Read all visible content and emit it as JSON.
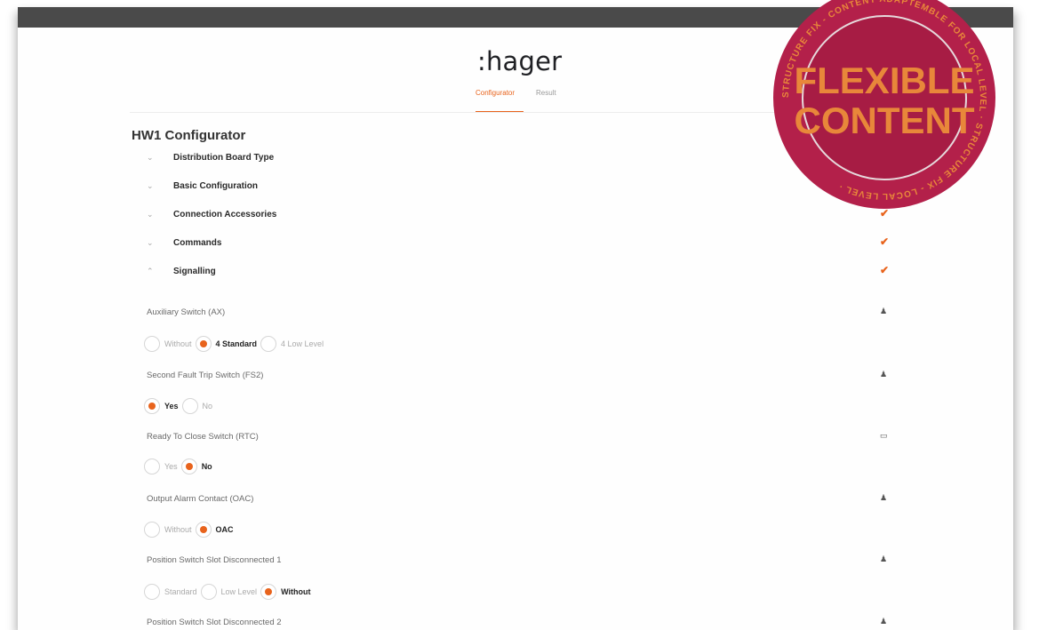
{
  "brand": {
    "logo": ":hager"
  },
  "tabs": [
    {
      "label": "Configurator",
      "active": true
    },
    {
      "label": "Result",
      "active": false
    }
  ],
  "page_title": "HW1 Configurator",
  "sections": [
    {
      "label": "Distribution Board Type",
      "expanded": false,
      "complete": false
    },
    {
      "label": "Basic Configuration",
      "expanded": false,
      "complete": false
    },
    {
      "label": "Connection Accessories",
      "expanded": false,
      "complete": true
    },
    {
      "label": "Commands",
      "expanded": false,
      "complete": true
    },
    {
      "label": "Signalling",
      "expanded": true,
      "complete": true
    }
  ],
  "fields": [
    {
      "label": "Auxiliary Switch (AX)",
      "icon": "user-icon",
      "options": [
        {
          "label": "Without",
          "selected": false
        },
        {
          "label": "4 Standard",
          "selected": true
        },
        {
          "label": "4 Low Level",
          "selected": false
        }
      ]
    },
    {
      "label": "Second Fault Trip Switch (FS2)",
      "icon": "user-icon",
      "options": [
        {
          "label": "Yes",
          "selected": true
        },
        {
          "label": "No",
          "selected": false
        }
      ]
    },
    {
      "label": "Ready To Close Switch (RTC)",
      "icon": "monitor-icon",
      "options": [
        {
          "label": "Yes",
          "selected": false
        },
        {
          "label": "No",
          "selected": true
        }
      ]
    },
    {
      "label": "Output Alarm Contact (OAC)",
      "icon": "user-icon",
      "options": [
        {
          "label": "Without",
          "selected": false
        },
        {
          "label": "OAC",
          "selected": true
        }
      ]
    },
    {
      "label": "Position Switch Slot Disconnected 1",
      "icon": "user-icon",
      "options": [
        {
          "label": "Standard",
          "selected": false
        },
        {
          "label": "Low Level",
          "selected": false
        },
        {
          "label": "Without",
          "selected": true
        }
      ]
    },
    {
      "label": "Position Switch Slot Disconnected 2",
      "icon": "user-icon",
      "options": []
    }
  ],
  "stamp": {
    "line1": "FLEXIBLE",
    "line2": "CONTENT",
    "ring_text": "STRUCTURE FIX - CONTENT ADAPTEMBLE FOR LOCAL LEVEL · STRUCTURE FIX - LOCAL LEVEL · ",
    "color": "#b3204a",
    "accent": "#e8873a"
  },
  "colors": {
    "accent": "#e8631c",
    "topbar": "#4a4a4a"
  }
}
